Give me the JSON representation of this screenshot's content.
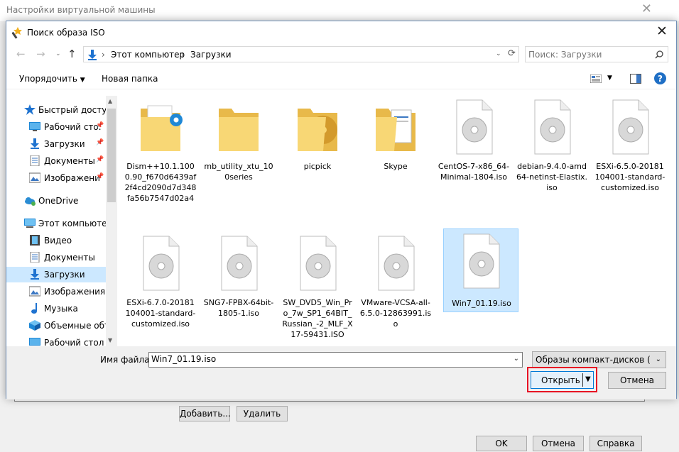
{
  "background_window": {
    "title": "Настройки виртуальной машины",
    "add_label": "Добавить...",
    "remove_label": "Удалить",
    "ok_label": "OK",
    "cancel_label": "Отмена",
    "help_label": "Справка"
  },
  "dialog": {
    "title": "Поиск образа ISO",
    "breadcrumb": [
      "Этот компьютер",
      "Загрузки"
    ],
    "search_placeholder": "Поиск: Загрузки",
    "toolbar": {
      "organize_label": "Упорядочить",
      "new_folder_label": "Новая папка"
    },
    "nav": [
      {
        "label": "Быстрый доступ",
        "icon": "star-icon",
        "pinned": false
      },
      {
        "label": "Рабочий сто.",
        "icon": "desktop-icon",
        "pinned": true
      },
      {
        "label": "Загрузки",
        "icon": "download-icon",
        "pinned": true
      },
      {
        "label": "Документы",
        "icon": "documents-icon",
        "pinned": true
      },
      {
        "label": "Изображени",
        "icon": "pictures-icon",
        "pinned": true
      },
      {
        "label": "OneDrive",
        "icon": "cloud-icon",
        "pinned": false
      },
      {
        "label": "Этот компьютер",
        "icon": "computer-icon",
        "pinned": false
      },
      {
        "label": "Видео",
        "icon": "video-icon",
        "pinned": false
      },
      {
        "label": "Документы",
        "icon": "documents-icon",
        "pinned": false
      },
      {
        "label": "Загрузки",
        "icon": "download-icon",
        "pinned": false,
        "selected": true
      },
      {
        "label": "Изображения",
        "icon": "pictures-icon",
        "pinned": false
      },
      {
        "label": "Музыка",
        "icon": "music-icon",
        "pinned": false
      },
      {
        "label": "Объемные объ",
        "icon": "3d-objects-icon",
        "pinned": false
      },
      {
        "label": "Рабочий стол",
        "icon": "desktop-icon",
        "pinned": false
      }
    ],
    "files": [
      {
        "name": "Dism++10.1.1000.90_f670d6439af2f4cd2090d7d348fa56b7547d02a4",
        "type": "folder",
        "variant": "gear"
      },
      {
        "name": "mb_utility_xtu_100series",
        "type": "folder",
        "variant": "plain"
      },
      {
        "name": "picpick",
        "type": "folder",
        "variant": "disc"
      },
      {
        "name": "Skype",
        "type": "folder",
        "variant": "doc"
      },
      {
        "name": "CentOS-7-x86_64-Minimal-1804.iso",
        "type": "iso"
      },
      {
        "name": "debian-9.4.0-amd64-netinst-Elastix.iso",
        "type": "iso"
      },
      {
        "name": "ESXi-6.5.0-20181104001-standard-customized.iso",
        "type": "iso"
      },
      {
        "name": "ESXi-6.7.0-20181104001-standard-customized.iso",
        "type": "iso"
      },
      {
        "name": "SNG7-FPBX-64bit-1805-1.iso",
        "type": "iso"
      },
      {
        "name": "SW_DVD5_Win_Pro_7w_SP1_64BIT_Russian_-2_MLF_X17-59431.ISO",
        "type": "iso"
      },
      {
        "name": "VMware-VCSA-all-6.5.0-12863991.iso",
        "type": "iso"
      },
      {
        "name": "Win7_01.19.iso",
        "type": "iso",
        "selected": true
      }
    ],
    "filename_label": "Имя файла:",
    "filename_value": "Win7_01.19.iso",
    "filetype_value": "Образы компакт-дисков (*.iso",
    "open_label": "Открыть",
    "cancel_label": "Отмена"
  },
  "colors": {
    "accent": "#0078d7",
    "selection": "#cce8ff",
    "highlight": "#e81123",
    "folder": "#f8d775"
  }
}
